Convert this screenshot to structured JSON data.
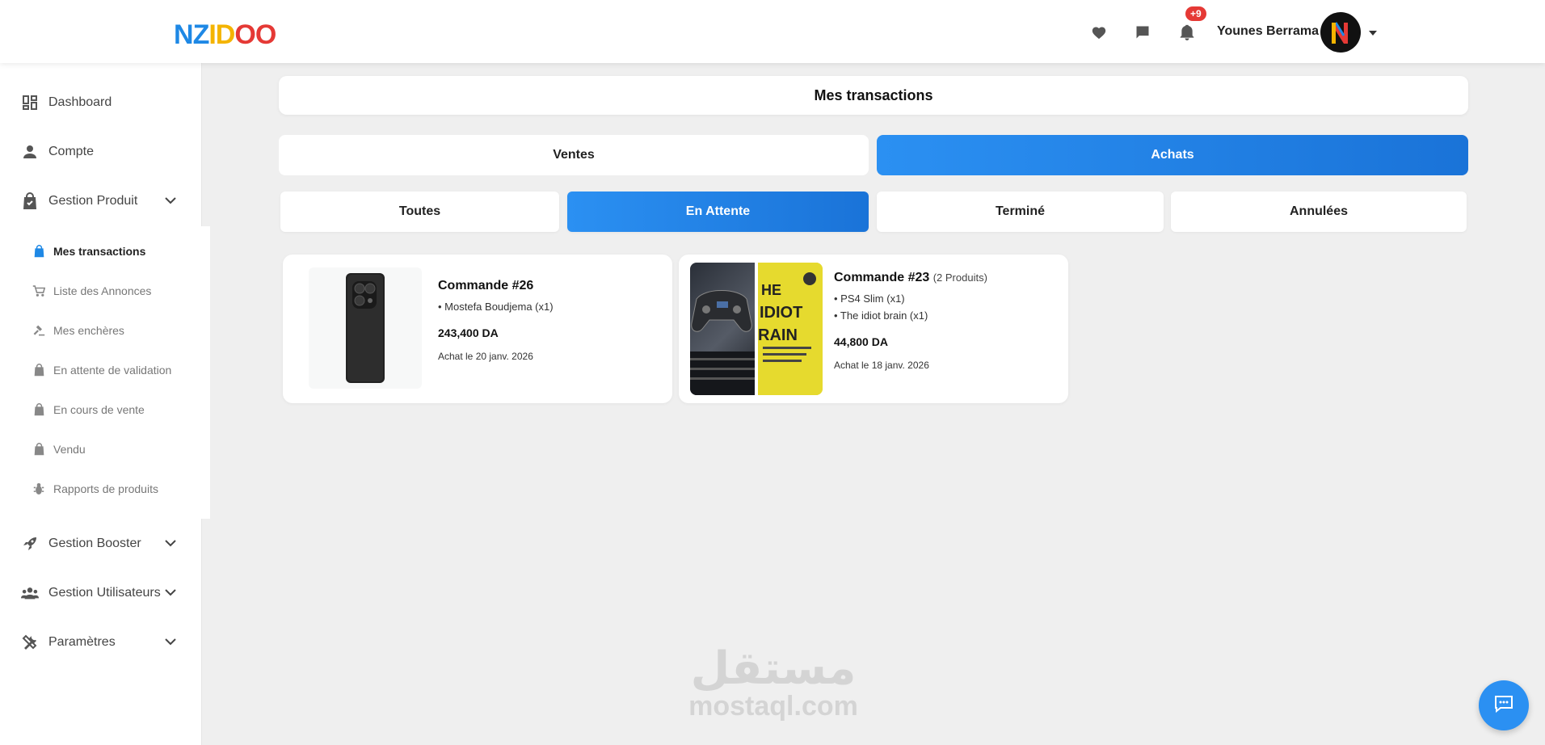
{
  "brand": {
    "letters": [
      "N",
      "Z",
      "I",
      "D",
      "O",
      "O"
    ],
    "colors": [
      "#1e88e5",
      "#1e88e5",
      "#f4b400",
      "#f4b400",
      "#e53935",
      "#e53935"
    ]
  },
  "header": {
    "notification_count": "+9",
    "username": "Younes Berrama",
    "icons": [
      "heart-icon",
      "chat-bubble-icon",
      "bell-icon",
      "caret-down-icon"
    ]
  },
  "sidebar": {
    "items": [
      {
        "label": "Dashboard",
        "icon": "dashboard-icon"
      },
      {
        "label": "Compte",
        "icon": "person-icon"
      },
      {
        "label": "Gestion Produit",
        "icon": "bag-icon",
        "expanded": true
      },
      {
        "label": "Gestion Booster",
        "icon": "rocket-icon"
      },
      {
        "label": "Gestion Utilisateurs",
        "icon": "users-icon"
      },
      {
        "label": "Paramètres",
        "icon": "tools-icon"
      }
    ],
    "sub_items": [
      {
        "label": "Mes transactions",
        "icon": "bag-icon",
        "active": true
      },
      {
        "label": "Liste des Annonces",
        "icon": "cart-icon"
      },
      {
        "label": "Mes enchères",
        "icon": "gavel-icon"
      },
      {
        "label": "En attente de validation",
        "icon": "bag-icon"
      },
      {
        "label": "En cours de vente",
        "icon": "bag-icon"
      },
      {
        "label": "Vendu",
        "icon": "bag-icon"
      },
      {
        "label": "Rapports de produits",
        "icon": "bug-icon"
      }
    ]
  },
  "page": {
    "title": "Mes transactions",
    "main_tabs": [
      {
        "label": "Ventes",
        "active": false
      },
      {
        "label": "Achats",
        "active": true
      }
    ],
    "status_tabs": [
      {
        "label": "Toutes",
        "active": false
      },
      {
        "label": "En Attente",
        "active": true
      },
      {
        "label": "Terminé",
        "active": false
      },
      {
        "label": "Annulées",
        "active": false
      }
    ]
  },
  "orders": [
    {
      "title": "Commande #26",
      "count": "",
      "items": [
        "• Mostefa Boudjema (x1)"
      ],
      "price": "243,400 DA",
      "date": "Achat le 20 janv. 2026"
    },
    {
      "title": "Commande #23",
      "count": "(2 Produits)",
      "items": [
        "• PS4 Slim (x1)",
        "• The idiot brain (x1)"
      ],
      "price": "44,800 DA",
      "date": "Achat le 18 janv. 2026"
    }
  ],
  "watermark": {
    "arabic": "مستقل",
    "latin": "mostaql.com"
  },
  "colors": {
    "accent": "#2b90f2",
    "badge": "#e53935"
  }
}
